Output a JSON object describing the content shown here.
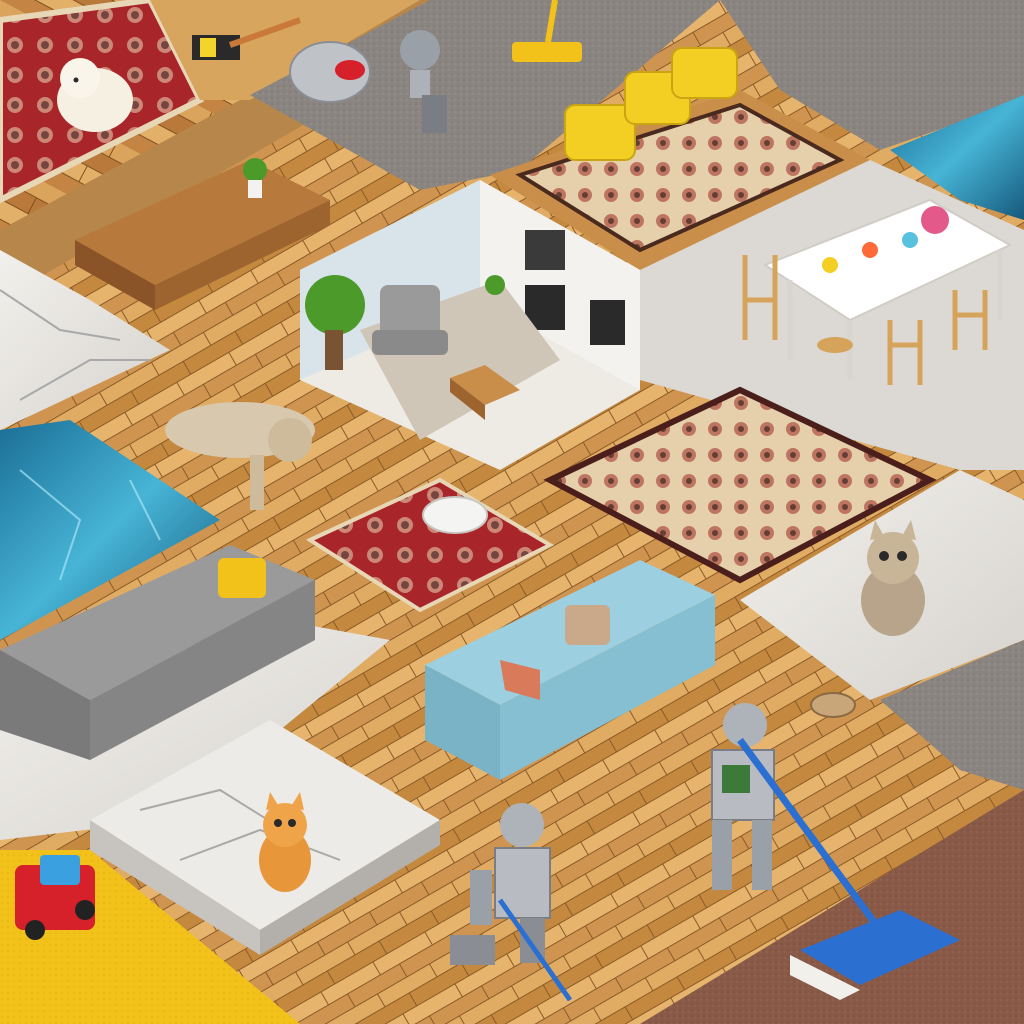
{
  "scene": {
    "description_visible_text": "",
    "palette": {
      "wood_light": "#e2b36a",
      "wood_mid": "#c98f4a",
      "wood_dark": "#9c6a34",
      "wood_line": "#8a5a28",
      "carpet_grey": "#8a8580",
      "carpet_grey_dark": "#6f6a66",
      "carpet_brown": "#8a5a48",
      "carpet_yellow": "#f2c21b",
      "marble": "#e9e6e2",
      "marble_vein": "#a9a9a9",
      "tile_light": "#e4e2de",
      "water_blue": "#1f7fa8",
      "water_light": "#47b4d6",
      "rug_red": "#a8262a",
      "rug_cream": "#e8d7b6",
      "sofa_grey": "#8c8c8c",
      "sofa_blue": "#8fc6d6",
      "chair_yellow": "#f2cf22",
      "robot_silver": "#b8bcc2",
      "cat_orange": "#e8963a",
      "cat_grey": "#c8b8a2",
      "toy_red": "#d6202a",
      "mop_blue": "#2b6fd0"
    },
    "icons": [
      "robot-icon",
      "cat-icon",
      "dog-icon",
      "sofa-icon",
      "rug-icon",
      "chair-icon",
      "table-icon",
      "mop-icon",
      "toy-car-icon",
      "plant-icon",
      "bowl-icon"
    ]
  }
}
